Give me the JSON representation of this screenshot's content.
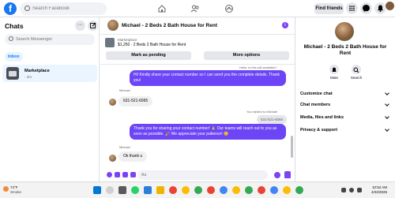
{
  "topbar": {
    "logo": "f",
    "search_placeholder": "Search Facebook",
    "find_friends": "Find friends"
  },
  "sidebar": {
    "title": "Chats",
    "more_label": "···",
    "search_placeholder": "Search Messenger",
    "inbox": "Inbox",
    "conversations": [
      {
        "name": "Marketplace",
        "time": "· 2m"
      }
    ]
  },
  "chat": {
    "title": "Michael - 2 Beds 2 Bath House for Rent",
    "info_label": "i",
    "listing": {
      "label": "Marketplace",
      "price_line": "$1,250 · 2 Beds 2 Bath House for Rent",
      "mark_pending": "Mark as pending",
      "more_options": "More options"
    },
    "messages": {
      "reply_1": "Hello, is this still available?",
      "out_1": "Hi! Kindly share your contact number so I can send you the complete details. Thank you!",
      "sender_1": "Michael",
      "in_1": "631-521-6065",
      "reply_2": "You replied to Michael",
      "reply_2_quote": "631-521-6065",
      "out_2": "Thank you for sharing your contact number! 🙏 Our teams will reach out to you as soon as possible. 🎉 We appreciate your patience! 😊",
      "sender_2": "Michael",
      "in_2": "Ok thank u"
    },
    "composer_placeholder": "Aa"
  },
  "rpanel": {
    "name": "Michael - 2 Beds 2 Bath House for Rent",
    "mute": "Mute",
    "search": "Search",
    "rows": [
      "Customize chat",
      "Chat members",
      "Media, files and links",
      "Privacy & support"
    ]
  },
  "taskbar": {
    "temp": "74°F",
    "condition": "Smoke",
    "time": "10:52 AM",
    "date": "4/22/2025"
  },
  "colors": {
    "accent": "#6b45f6",
    "brand": "#1877f2"
  }
}
